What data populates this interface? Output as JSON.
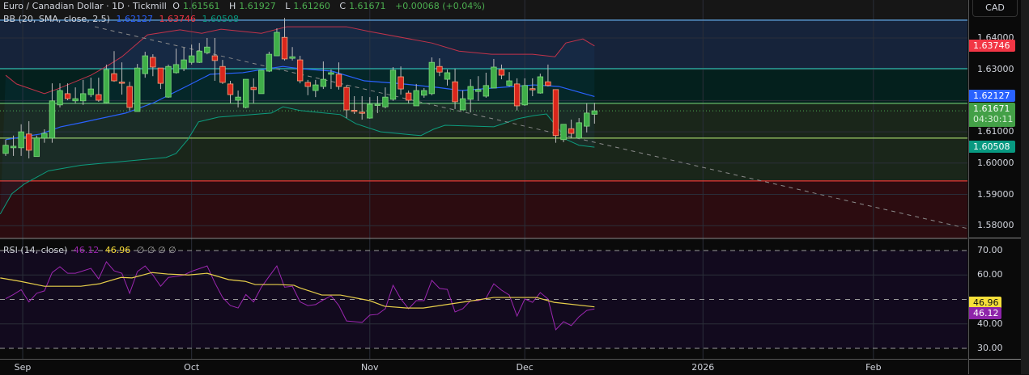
{
  "header": {
    "symbol": "Euro / Canadian Dollar · 1D · Tickmill",
    "open_label": "O",
    "open": "1.61561",
    "high_label": "H",
    "high": "1.61927",
    "low_label": "L",
    "low": "1.61260",
    "close_label": "C",
    "close": "1.61671",
    "change": "+0.00068 (+0.04%)"
  },
  "bb_legend": {
    "label": "BB (20, SMA, close, 2.5)",
    "basis": "1.62127",
    "upper": "1.63746",
    "lower": "1.60508"
  },
  "rsi_legend": {
    "label": "RSI (14, close)",
    "rsi": "46.12",
    "ma": "46.96",
    "extras": "∅ ∅ ∅ ∅"
  },
  "currency_button": "CAD",
  "price_axis": {
    "ticks": [
      "1.64000",
      "1.63000",
      "1.61000",
      "1.60000",
      "1.59000",
      "1.58000"
    ],
    "tick_values": [
      1.64,
      1.63,
      1.61,
      1.6,
      1.59,
      1.58
    ]
  },
  "price_badges": {
    "upper": "1.63746",
    "basis": "1.62127",
    "last": "1.61671",
    "countdown": "04:30:11",
    "lower": "1.60508"
  },
  "rsi_axis": {
    "ticks": [
      "70.00",
      "60.00",
      "40.00",
      "30.00"
    ],
    "tick_values": [
      70,
      60,
      40,
      30
    ]
  },
  "rsi_badges": {
    "ma": "46.96",
    "rsi": "46.12"
  },
  "time_axis": [
    {
      "label": "Sep",
      "bar": 2.2
    },
    {
      "label": "Oct",
      "bar": 24
    },
    {
      "label": "Nov",
      "bar": 47
    },
    {
      "label": "Dec",
      "bar": 67
    },
    {
      "label": "2026",
      "bar": 90
    },
    {
      "label": "Feb",
      "bar": 112
    }
  ],
  "colors": {
    "up": "#4caf50",
    "down": "#e53935",
    "bb_basis": "#2962ff",
    "bb_upper": "#f23645",
    "bb_lower": "#089981",
    "rsi": "#9c27b0",
    "rsi_ma": "#f7dc3a"
  },
  "chart_data": {
    "type": "candlestick",
    "candles_ohlc": [
      [
        1.6031,
        1.6075,
        1.6023,
        1.6057
      ],
      [
        1.6049,
        1.6088,
        1.6023,
        1.6054
      ],
      [
        1.6049,
        1.6124,
        1.6023,
        1.61
      ],
      [
        1.6093,
        1.6134,
        1.6015,
        1.6041
      ],
      [
        1.6021,
        1.6088,
        1.6021,
        1.608
      ],
      [
        1.608,
        1.6108,
        1.6065,
        1.6095
      ],
      [
        1.608,
        1.6255,
        1.6065,
        1.6199
      ],
      [
        1.6186,
        1.6255,
        1.6178,
        1.6232
      ],
      [
        1.6222,
        1.6255,
        1.6201,
        1.6206
      ],
      [
        1.6199,
        1.6242,
        1.6191,
        1.6206
      ],
      [
        1.6199,
        1.6266,
        1.6186,
        1.6222
      ],
      [
        1.6219,
        1.6273,
        1.6211,
        1.6237
      ],
      [
        1.6219,
        1.6273,
        1.6196,
        1.6201
      ],
      [
        1.6193,
        1.6315,
        1.6191,
        1.6299
      ],
      [
        1.6286,
        1.6358,
        1.626,
        1.6263
      ],
      [
        1.6259,
        1.6322,
        1.6219,
        1.6258
      ],
      [
        1.6245,
        1.626,
        1.6168,
        1.6178
      ],
      [
        1.6165,
        1.6317,
        1.6165,
        1.6304
      ],
      [
        1.6286,
        1.6356,
        1.6273,
        1.6343
      ],
      [
        1.6338,
        1.6348,
        1.6278,
        1.6307
      ],
      [
        1.6304,
        1.6304,
        1.6237,
        1.6255
      ],
      [
        1.6211,
        1.6315,
        1.6209,
        1.6309
      ],
      [
        1.6289,
        1.6366,
        1.6286,
        1.6315
      ],
      [
        1.6302,
        1.6369,
        1.6294,
        1.633
      ],
      [
        1.6322,
        1.6379,
        1.6315,
        1.6343
      ],
      [
        1.6322,
        1.6384,
        1.632,
        1.6358
      ],
      [
        1.6353,
        1.64,
        1.6348,
        1.6371
      ],
      [
        1.6343,
        1.64,
        1.6263,
        1.6328
      ],
      [
        1.6309,
        1.633,
        1.6253,
        1.6258
      ],
      [
        1.6253,
        1.6263,
        1.6191,
        1.6219
      ],
      [
        1.6201,
        1.6232,
        1.6178,
        1.6211
      ],
      [
        1.6178,
        1.6268,
        1.6175,
        1.6268
      ],
      [
        1.6242,
        1.6271,
        1.6191,
        1.6235
      ],
      [
        1.6222,
        1.6297,
        1.6222,
        1.6297
      ],
      [
        1.6294,
        1.6356,
        1.6291,
        1.6348
      ],
      [
        1.6343,
        1.6431,
        1.6343,
        1.6418
      ],
      [
        1.6402,
        1.6464,
        1.6328,
        1.6333
      ],
      [
        1.6335,
        1.6371,
        1.6328,
        1.634
      ],
      [
        1.633,
        1.6343,
        1.6255,
        1.6263
      ],
      [
        1.6258,
        1.6266,
        1.6217,
        1.6245
      ],
      [
        1.6232,
        1.6266,
        1.6211,
        1.625
      ],
      [
        1.6245,
        1.6325,
        1.6237,
        1.6268
      ],
      [
        1.6284,
        1.6299,
        1.6237,
        1.6289
      ],
      [
        1.6284,
        1.6322,
        1.6235,
        1.6245
      ],
      [
        1.6242,
        1.625,
        1.6144,
        1.617
      ],
      [
        1.6169,
        1.6214,
        1.6157,
        1.6168
      ],
      [
        1.6163,
        1.6214,
        1.6139,
        1.6162
      ],
      [
        1.6144,
        1.6211,
        1.6142,
        1.6188
      ],
      [
        1.6186,
        1.6214,
        1.616,
        1.6188
      ],
      [
        1.618,
        1.6242,
        1.6175,
        1.6211
      ],
      [
        1.6204,
        1.6307,
        1.6199,
        1.6297
      ],
      [
        1.6276,
        1.6309,
        1.6219,
        1.6237
      ],
      [
        1.6224,
        1.6232,
        1.6191,
        1.6201
      ],
      [
        1.6183,
        1.6253,
        1.6183,
        1.6232
      ],
      [
        1.6217,
        1.624,
        1.6209,
        1.6232
      ],
      [
        1.6222,
        1.6338,
        1.6217,
        1.6322
      ],
      [
        1.6309,
        1.6335,
        1.6278,
        1.6291
      ],
      [
        1.6268,
        1.6299,
        1.6248,
        1.6289
      ],
      [
        1.626,
        1.6302,
        1.6173,
        1.6196
      ],
      [
        1.617,
        1.6232,
        1.617,
        1.6206
      ],
      [
        1.6204,
        1.6268,
        1.6162,
        1.6245
      ],
      [
        1.6229,
        1.6278,
        1.6199,
        1.6235
      ],
      [
        1.6214,
        1.6289,
        1.6209,
        1.6248
      ],
      [
        1.624,
        1.6333,
        1.624,
        1.6307
      ],
      [
        1.6299,
        1.6315,
        1.6268,
        1.6281
      ],
      [
        1.6248,
        1.6291,
        1.6245,
        1.6263
      ],
      [
        1.6253,
        1.6271,
        1.6168,
        1.6183
      ],
      [
        1.6186,
        1.6271,
        1.6183,
        1.6248
      ],
      [
        1.6238,
        1.6271,
        1.6214,
        1.6237
      ],
      [
        1.6224,
        1.6286,
        1.6222,
        1.6276
      ],
      [
        1.626,
        1.6315,
        1.6245,
        1.6248
      ],
      [
        1.6235,
        1.6235,
        1.6065,
        1.6088
      ],
      [
        1.6075,
        1.6124,
        1.6067,
        1.6124
      ],
      [
        1.611,
        1.6139,
        1.608,
        1.6095
      ],
      [
        1.608,
        1.6144,
        1.608,
        1.6129
      ],
      [
        1.6118,
        1.6191,
        1.6098,
        1.616
      ],
      [
        1.61561,
        1.61927,
        1.6126,
        1.61671
      ]
    ],
    "bb_upper": [
      [
        0,
        1.6281
      ],
      [
        1.4,
        1.6253
      ],
      [
        5,
        1.6222
      ],
      [
        6.7,
        1.6237
      ],
      [
        11,
        1.6281
      ],
      [
        13,
        1.6309
      ],
      [
        15,
        1.634
      ],
      [
        18.3,
        1.641
      ],
      [
        22.5,
        1.6426
      ],
      [
        25.3,
        1.6415
      ],
      [
        27.8,
        1.6428
      ],
      [
        33,
        1.6415
      ],
      [
        36.3,
        1.6436
      ],
      [
        44,
        1.6436
      ],
      [
        46.9,
        1.6421
      ],
      [
        55,
        1.6384
      ],
      [
        58.5,
        1.6358
      ],
      [
        62.7,
        1.6348
      ],
      [
        68,
        1.6348
      ],
      [
        70.9,
        1.634
      ],
      [
        72.3,
        1.6384
      ],
      [
        74.5,
        1.6397
      ],
      [
        76,
        1.63746
      ]
    ],
    "bb_basis": [
      [
        0,
        1.6075
      ],
      [
        4.5,
        1.6093
      ],
      [
        7.1,
        1.6116
      ],
      [
        9.7,
        1.6129
      ],
      [
        15.5,
        1.616
      ],
      [
        19.1,
        1.6193
      ],
      [
        23.3,
        1.6245
      ],
      [
        26.4,
        1.6284
      ],
      [
        30.6,
        1.6289
      ],
      [
        33.8,
        1.6302
      ],
      [
        35.8,
        1.6309
      ],
      [
        38,
        1.6302
      ],
      [
        42.1,
        1.6294
      ],
      [
        46.3,
        1.6263
      ],
      [
        50.5,
        1.6255
      ],
      [
        55.7,
        1.6242
      ],
      [
        58.8,
        1.6232
      ],
      [
        64,
        1.6242
      ],
      [
        68.2,
        1.625
      ],
      [
        71.4,
        1.6245
      ],
      [
        76,
        1.62127
      ]
    ],
    "bb_lower": [
      [
        -0.7,
        1.5837
      ],
      [
        0.8,
        1.5902
      ],
      [
        2.4,
        1.5933
      ],
      [
        5.5,
        1.5975
      ],
      [
        9.7,
        1.5993
      ],
      [
        15,
        1.6005
      ],
      [
        20.7,
        1.6018
      ],
      [
        22,
        1.6031
      ],
      [
        23.5,
        1.6075
      ],
      [
        24.9,
        1.6132
      ],
      [
        27.5,
        1.6147
      ],
      [
        31.7,
        1.6155
      ],
      [
        34.3,
        1.616
      ],
      [
        35.8,
        1.618
      ],
      [
        38,
        1.6168
      ],
      [
        43.2,
        1.6155
      ],
      [
        45.2,
        1.6126
      ],
      [
        48.4,
        1.61
      ],
      [
        52.6,
        1.609
      ],
      [
        53.6,
        1.6088
      ],
      [
        55.2,
        1.6108
      ],
      [
        56.7,
        1.6121
      ],
      [
        63,
        1.6116
      ],
      [
        64.6,
        1.6129
      ],
      [
        66.1,
        1.6142
      ],
      [
        68.2,
        1.6152
      ],
      [
        69.8,
        1.6157
      ],
      [
        71.4,
        1.6108
      ],
      [
        72.4,
        1.6075
      ],
      [
        74,
        1.6057
      ],
      [
        76,
        1.60508
      ]
    ],
    "horizontal_levels": [
      {
        "price": 1.6457,
        "color": "#5b9bd5"
      },
      {
        "price": 1.6302,
        "color": "#26a69a"
      },
      {
        "price": 1.6191,
        "color": "#66bb6a"
      },
      {
        "price": 1.608,
        "color": "#9ccc65"
      },
      {
        "price": 1.5943,
        "color": "#e53935"
      }
    ],
    "zones": [
      {
        "from": 1.6457,
        "to": 1.6302,
        "color": "#16233a"
      },
      {
        "from": 1.6302,
        "to": 1.6191,
        "color": "#04201d"
      },
      {
        "from": 1.6191,
        "to": 1.5943,
        "color": "#1a261a"
      },
      {
        "from": 1.5943,
        "to": 1.57,
        "color": "#2c0c10"
      }
    ],
    "trendline": [
      [
        11.5,
        1.6436
      ],
      [
        124.1,
        1.5791
      ]
    ],
    "last_price": 1.61671,
    "price_range": [
      1.573,
      1.652
    ],
    "rsi": [
      50.3,
      52,
      54,
      49,
      52.5,
      53.5,
      61,
      63.4,
      60.7,
      60.7,
      61.7,
      62.7,
      58.4,
      65.4,
      61.7,
      60.7,
      52.5,
      61.4,
      63.7,
      60,
      55.4,
      59,
      59.4,
      60,
      61.5,
      62.6,
      63.7,
      56.8,
      50.8,
      47.5,
      46.5,
      52,
      49,
      55,
      59.4,
      63.7,
      55,
      55.4,
      49,
      47.5,
      47.9,
      49.8,
      51.5,
      47.5,
      41.2,
      40.9,
      40.6,
      43.6,
      43.9,
      46.2,
      55.8,
      50.2,
      46.2,
      49.5,
      49.5,
      57.8,
      54.5,
      54.1,
      44.9,
      46.2,
      49.5,
      49.5,
      50.5,
      56.4,
      53.8,
      51.8,
      43.2,
      50.2,
      48.8,
      52.8,
      50.2,
      37.6,
      40.9,
      39.3,
      42.9,
      45.5,
      46.12
    ],
    "rsi_ma": [
      [
        -0.7,
        58.8
      ],
      [
        1.9,
        57.4
      ],
      [
        5,
        55.4
      ],
      [
        9.7,
        55.4
      ],
      [
        12.1,
        56.4
      ],
      [
        14.9,
        59
      ],
      [
        16.3,
        58.8
      ],
      [
        18.9,
        61
      ],
      [
        20.9,
        60.4
      ],
      [
        23.6,
        60
      ],
      [
        26,
        60.7
      ],
      [
        28.8,
        58.1
      ],
      [
        30.9,
        57.4
      ],
      [
        32.2,
        56.1
      ],
      [
        35.1,
        56.1
      ],
      [
        37.2,
        55.8
      ],
      [
        37.9,
        54.8
      ],
      [
        40.8,
        51.8
      ],
      [
        43.2,
        51.8
      ],
      [
        47,
        49.5
      ],
      [
        48.9,
        47.2
      ],
      [
        51.8,
        46.5
      ],
      [
        53.9,
        46.5
      ],
      [
        58.8,
        48.8
      ],
      [
        63,
        50.8
      ],
      [
        68.5,
        50.8
      ],
      [
        70.8,
        48.8
      ],
      [
        76,
        46.96
      ]
    ],
    "rsi_levels": [
      70,
      50,
      30
    ]
  }
}
